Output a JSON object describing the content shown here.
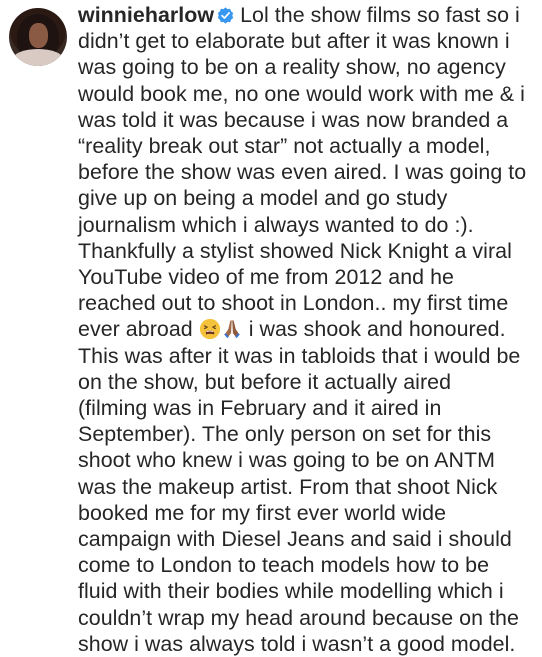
{
  "comment": {
    "username": "winnieharlow",
    "verified_badge": "verified-badge-icon",
    "first_line_text": " Lol the show films so fast so i",
    "lines": [
      "didn’t get to elaborate but after it was known i",
      "was going to be on a reality show, no agency",
      "would book me, no one would work with me & i",
      "was told it was because i was now branded a",
      "“reality break out star” not actually a model,",
      "before the show was even aired. I was going to",
      "give up on being a model and go study",
      "journalism which i always wanted to do :).",
      "Thankfully a stylist showed Nick Knight a viral",
      "YouTube video of me from 2012 and he",
      "reached out to shoot in London.. my first time"
    ],
    "emoji_line_prefix": "ever abroad ",
    "emoji_line_suffix": " i was shook and honoured.",
    "emojis": [
      "tired-face-emoji",
      "folded-hands-emoji"
    ],
    "lines_after": [
      "This was after it was in tabloids that i would be",
      "on the show, but before it actually aired",
      "(filming was in February and it aired in",
      "September). The only person on set for this",
      "shoot who knew i was going to be on ANTM",
      "was the makeup artist. From that shoot Nick",
      "booked me for my first ever world wide",
      "campaign with Diesel Jeans and said i should",
      "come to London to teach models how to be",
      "fluid with their bodies while modelling which i",
      "couldn’t wrap my head around because on the",
      "show i was always told i wasn’t a good model."
    ]
  },
  "colors": {
    "text": "#262626",
    "verified_blue": "#3897f0",
    "background": "#ffffff"
  }
}
